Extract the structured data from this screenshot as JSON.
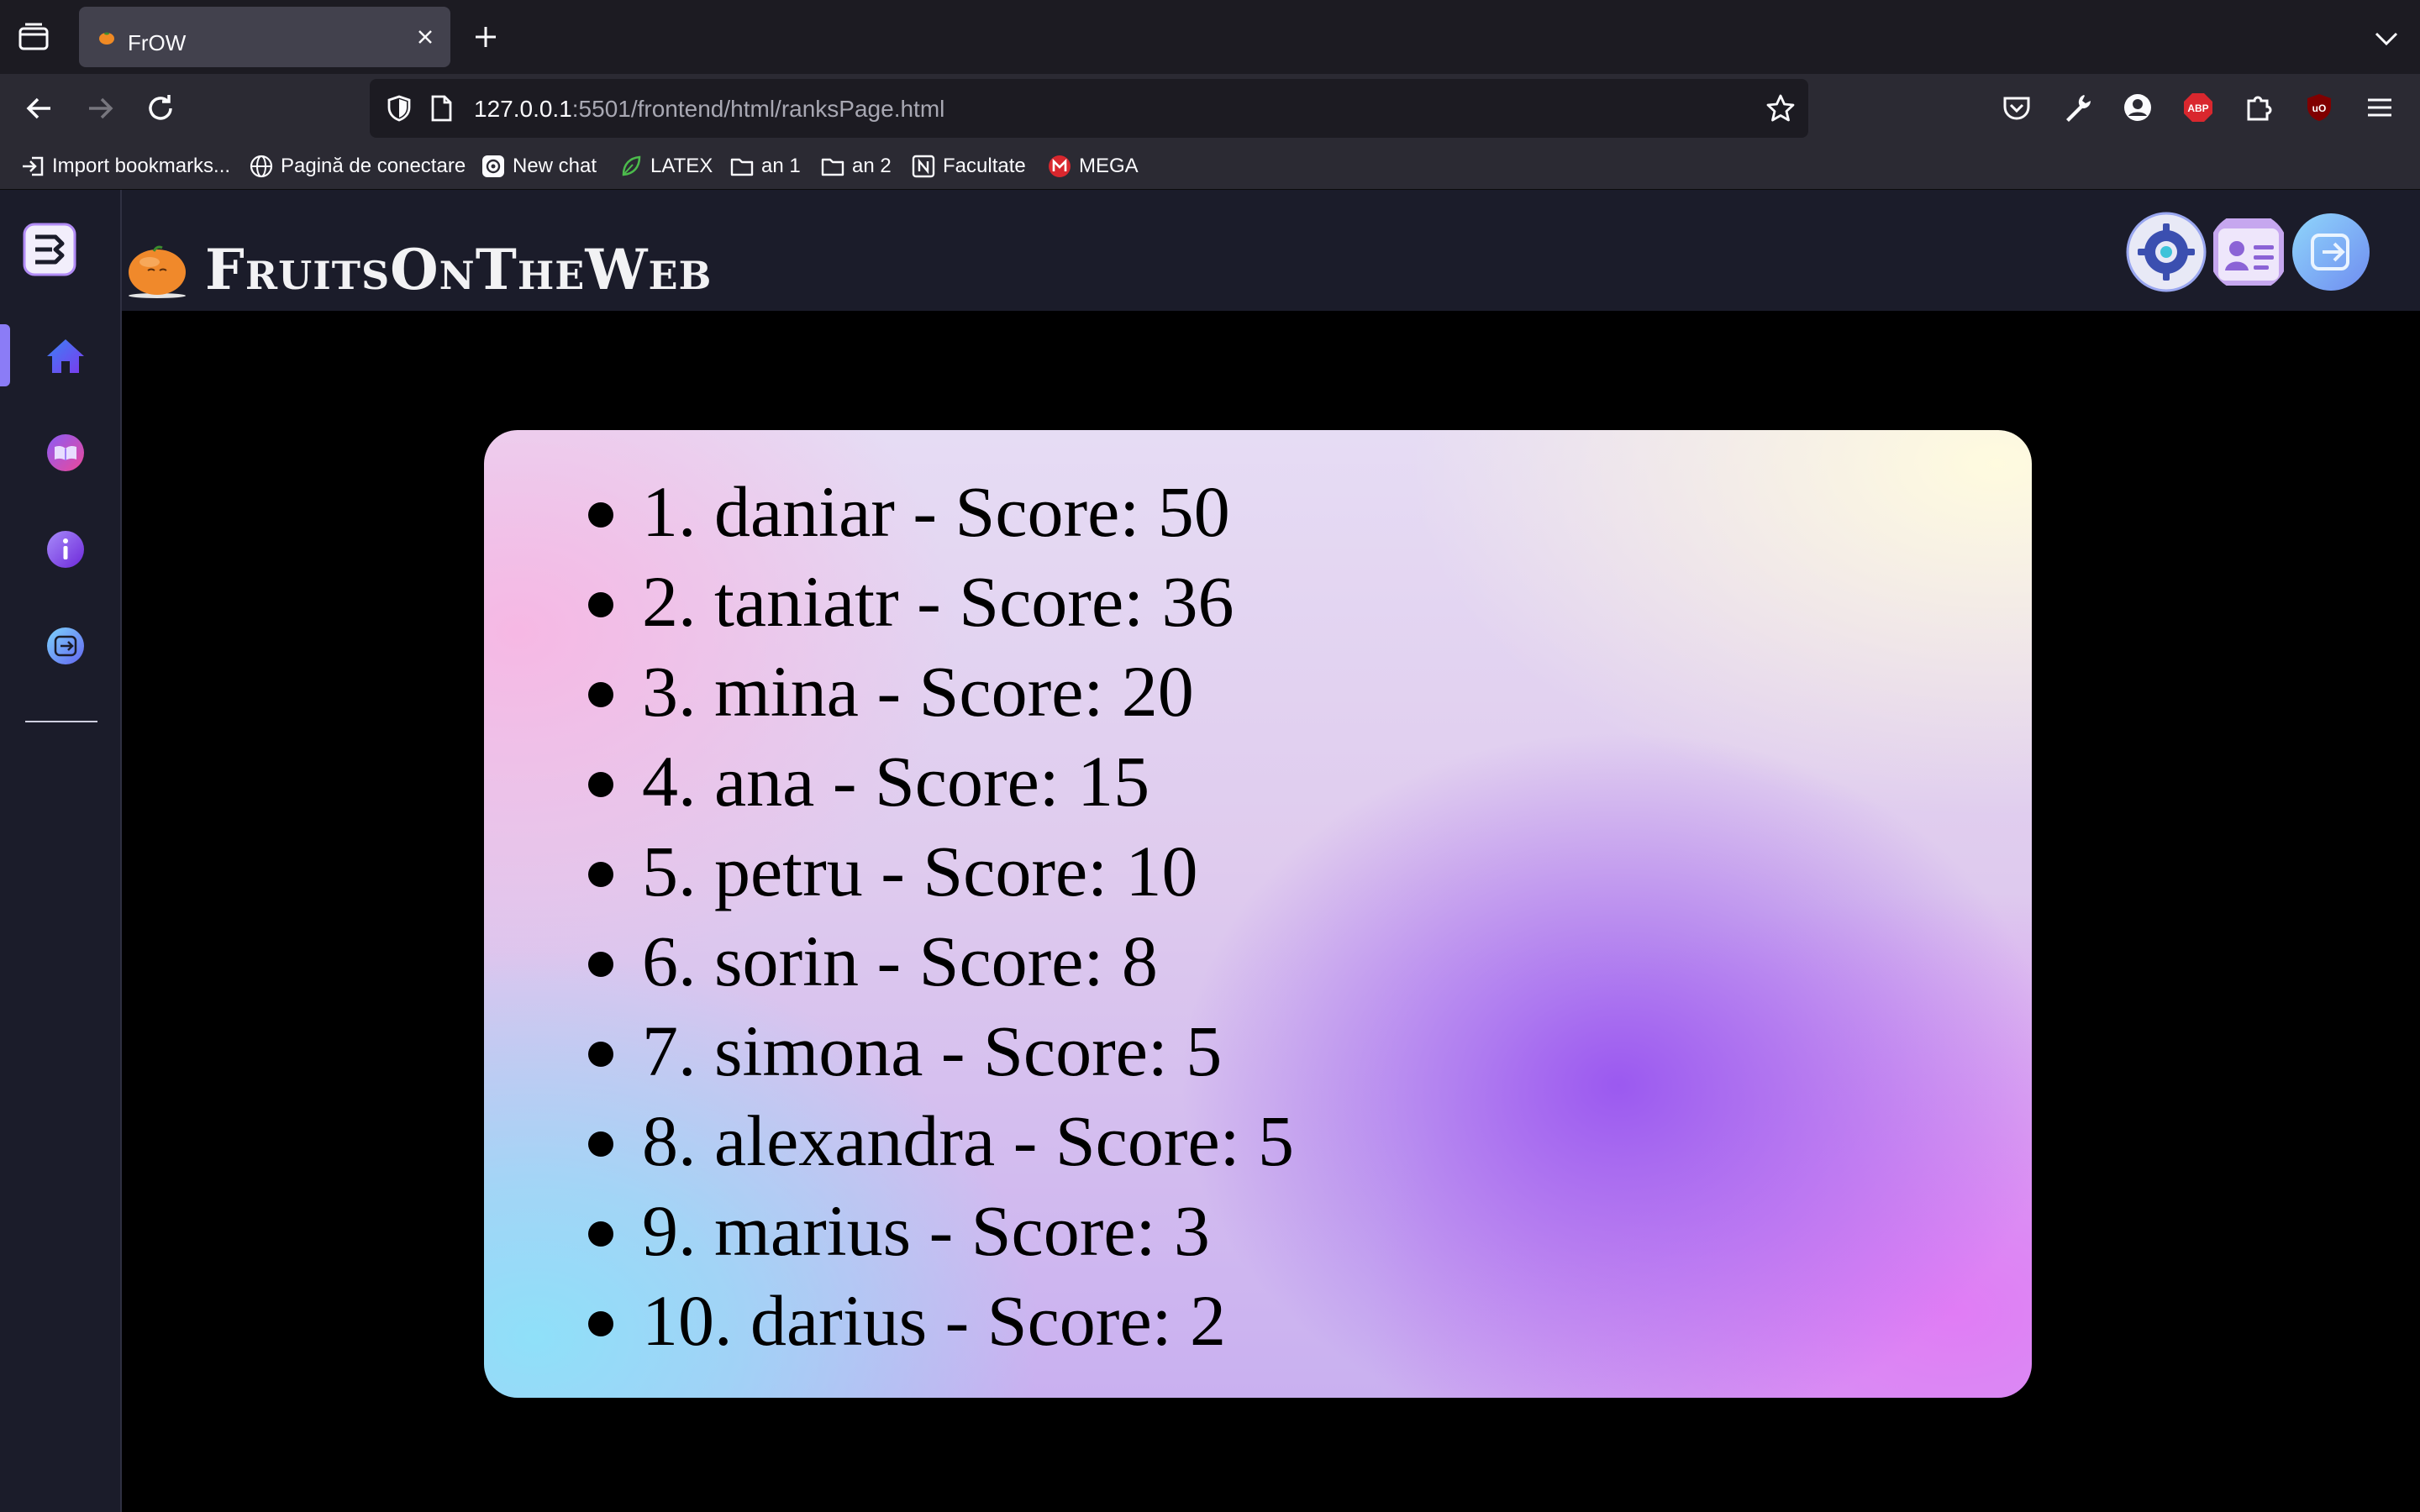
{
  "browser": {
    "tab": {
      "title": "FrOW"
    },
    "url": {
      "host": "127.0.0.1",
      "rest": ":5501/frontend/html/ranksPage.html"
    },
    "bookmarks": [
      {
        "label": "Import bookmarks...",
        "icon": "import-icon"
      },
      {
        "label": "Pagină de conectare",
        "icon": "globe-icon"
      },
      {
        "label": "New chat",
        "icon": "openai-icon"
      },
      {
        "label": "LATEX",
        "icon": "leaf-icon"
      },
      {
        "label": "an 1",
        "icon": "folder-icon"
      },
      {
        "label": "an 2",
        "icon": "folder-icon"
      },
      {
        "label": "Facultate",
        "icon": "notion-icon"
      },
      {
        "label": "MEGA",
        "icon": "mega-icon"
      }
    ],
    "toolbar_icons": [
      "pocket-icon",
      "wrench-icon",
      "account-icon",
      "adblock-icon",
      "extensions-icon",
      "ublock-icon",
      "menu-icon"
    ]
  },
  "app": {
    "title": "FruitsOnTheWeb",
    "sidebar": [
      "home-icon",
      "book-icon",
      "info-icon",
      "logout-icon"
    ],
    "header_actions": [
      "settings-icon",
      "profile-icon",
      "logout-icon"
    ],
    "colors": {
      "sidebar_bg": "#1b1c2a",
      "active_accent": "#8b7cf6"
    }
  },
  "ranks": [
    "1. daniar - Score: 50",
    "2. taniatr - Score: 36",
    "3. mina - Score: 20",
    "4. ana - Score: 15",
    "5. petru - Score: 10",
    "6. sorin - Score: 8",
    "7. simona - Score: 5",
    "8. alexandra - Score: 5",
    "9. marius - Score: 3",
    "10. darius - Score: 2"
  ]
}
